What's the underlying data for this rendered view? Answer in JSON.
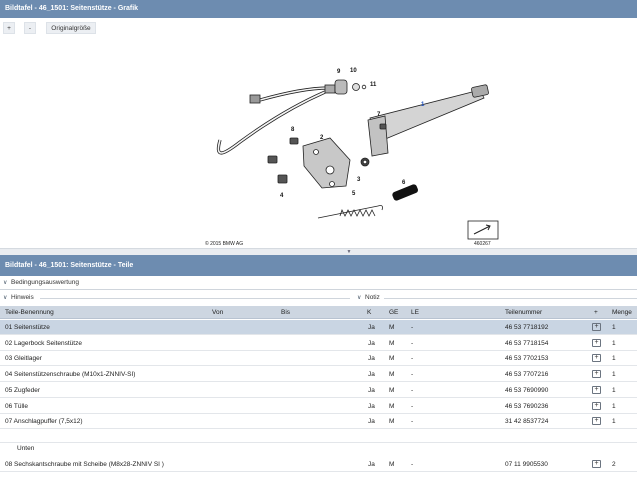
{
  "graphic_panel": {
    "title": "Bildtafel - 46_1501: Seitenstütze - Grafik",
    "zoom_in_label": "+",
    "zoom_out_label": "-",
    "original_size_label": "Originalgröße",
    "copyright": "© 2015 BMW AG",
    "image_number": "460267",
    "callouts": [
      "1",
      "2",
      "3",
      "4",
      "5",
      "6",
      "7",
      "8",
      "9",
      "10",
      "11"
    ]
  },
  "parts_panel": {
    "title": "Bildtafel - 46_1501: Seitenstütze - Teile",
    "conditions_label": "Bedingungsauswertung",
    "hint_label": "Hinweis",
    "notes_label": "Notiz",
    "columns": {
      "name": "Teile-Benennung",
      "from": "Von",
      "to": "Bis",
      "k": "K",
      "ge": "GE",
      "le": "LE",
      "part_number": "Teilenummer",
      "add": "+",
      "qty": "Menge"
    },
    "rows": [
      {
        "name": "01 Seitenstütze",
        "k": "Ja",
        "ge": "M",
        "le": "-",
        "part_number": "46 53 7718192",
        "qty": "1"
      },
      {
        "name": "02 Lagerbock Seitenstütze",
        "k": "Ja",
        "ge": "M",
        "le": "-",
        "part_number": "46 53 7718154",
        "qty": "1"
      },
      {
        "name": "03 Gleitlager",
        "k": "Ja",
        "ge": "M",
        "le": "-",
        "part_number": "46 53 7702153",
        "qty": "1"
      },
      {
        "name": "04 Seitenstützenschraube (M10x1-ZNNIV-SI)",
        "k": "Ja",
        "ge": "M",
        "le": "-",
        "part_number": "46 53 7707216",
        "qty": "1"
      },
      {
        "name": "05 Zugfeder",
        "k": "Ja",
        "ge": "M",
        "le": "-",
        "part_number": "46 53 7690990",
        "qty": "1"
      },
      {
        "name": "06 Tülle",
        "k": "Ja",
        "ge": "M",
        "le": "-",
        "part_number": "46 53 7690236",
        "qty": "1"
      },
      {
        "name": "07 Anschlagpuffer (7,5x12)",
        "k": "Ja",
        "ge": "M",
        "le": "-",
        "part_number": "31 42 8537724",
        "qty": "1"
      }
    ],
    "group_label": "Unten",
    "group_rows": [
      {
        "name": "08 Sechskantschraube mit Scheibe (M8x28-ZNNIV SI )",
        "k": "Ja",
        "ge": "M",
        "le": "-",
        "part_number": "07 11 9905530",
        "qty": "2"
      }
    ]
  }
}
